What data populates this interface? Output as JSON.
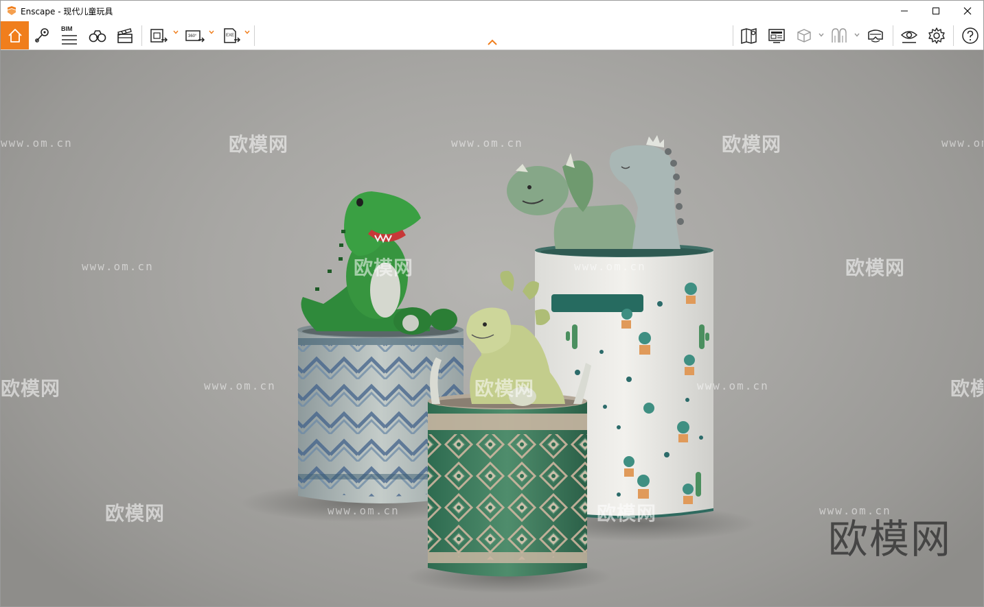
{
  "window": {
    "title": "Enscape - 现代儿童玩具",
    "accent_color": "#f07e1c"
  },
  "toolbar": {
    "bim_label": "BIM",
    "panorama_label": "360°",
    "exe_label": "EXE",
    "left_icons": [
      "home-icon",
      "location-pin-icon",
      "bim-icon",
      "binoculars-icon",
      "clapperboard-icon",
      "screenshot-export-icon",
      "panorama-export-icon",
      "exe-export-icon"
    ],
    "right_icons": [
      "map-icon",
      "monitor-icon",
      "cube-icon",
      "archway-icon",
      "vr-headset-icon",
      "eye-icon",
      "gear-icon",
      "help-icon"
    ]
  },
  "watermark": {
    "url": "www.om.cn",
    "logo": "欧模网",
    "corner": "欧模网"
  }
}
